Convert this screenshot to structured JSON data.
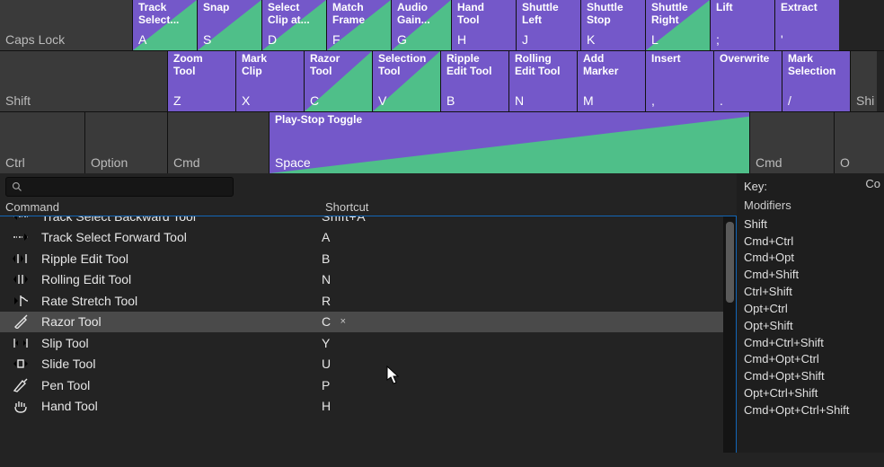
{
  "keyboard": {
    "row1_prefix": {
      "caps": "Caps Lock"
    },
    "row1": [
      {
        "top": "Track\nSelect...",
        "bot": "A",
        "intr": true,
        "triangle": true
      },
      {
        "top": "Snap",
        "bot": "S",
        "intr": true,
        "triangle": true
      },
      {
        "top": "Select\nClip at...",
        "bot": "D",
        "intr": true,
        "triangle": true
      },
      {
        "top": "Match\nFrame",
        "bot": "F",
        "intr": true,
        "triangle": true
      },
      {
        "top": "Audio\nGain...",
        "bot": "G",
        "intr": true,
        "triangle": true
      },
      {
        "top": "Hand\nTool",
        "bot": "H",
        "intr": true,
        "triangle": false
      },
      {
        "top": "Shuttle\nLeft",
        "bot": "J",
        "intr": true,
        "triangle": false
      },
      {
        "top": "Shuttle\nStop",
        "bot": "K",
        "intr": true,
        "triangle": false
      },
      {
        "top": "Shuttle\nRight",
        "bot": "L",
        "intr": true,
        "triangle": true
      },
      {
        "top": "Lift",
        "bot": ";",
        "intr": true,
        "triangle": false
      },
      {
        "top": "Extract",
        "bot": "'",
        "intr": true,
        "triangle": false
      }
    ],
    "row2_prefix": {
      "shift": "Shift"
    },
    "row2": [
      {
        "top": "Zoom\nTool",
        "bot": "Z",
        "intr": true,
        "triangle": false
      },
      {
        "top": "Mark\nClip",
        "bot": "X",
        "intr": true,
        "triangle": false
      },
      {
        "top": "Razor\nTool",
        "bot": "C",
        "intr": true,
        "triangle": true
      },
      {
        "top": "Selection\nTool",
        "bot": "V",
        "intr": true,
        "triangle": true
      },
      {
        "top": "Ripple\nEdit Tool",
        "bot": "B",
        "intr": true,
        "triangle": false
      },
      {
        "top": "Rolling\nEdit Tool",
        "bot": "N",
        "intr": true,
        "triangle": false
      },
      {
        "top": "Add\nMarker",
        "bot": "M",
        "intr": true,
        "triangle": false
      },
      {
        "top": "Insert",
        "bot": ",",
        "intr": true,
        "triangle": false
      },
      {
        "top": "Overwrite",
        "bot": ".",
        "intr": true,
        "triangle": false
      },
      {
        "top": "Mark\nSelection",
        "bot": "/",
        "intr": true,
        "triangle": false
      }
    ],
    "row2_suffix": {
      "type": "dark",
      "bot": "Shi"
    },
    "row3": [
      "Ctrl",
      "Option",
      "Cmd"
    ],
    "space": {
      "top": "Play-Stop Toggle",
      "bot": "Space"
    },
    "row3_right": [
      "Cmd",
      "O"
    ]
  },
  "panel": {
    "search_placeholder": "",
    "cols": {
      "command": "Command",
      "shortcut": "Shortcut"
    },
    "commands": [
      {
        "icon": "track-back",
        "name": "Track Select Backward Tool",
        "shortcut": "Shift+A"
      },
      {
        "icon": "track-fwd",
        "name": "Track Select Forward Tool",
        "shortcut": "A"
      },
      {
        "icon": "ripple",
        "name": "Ripple Edit Tool",
        "shortcut": "B"
      },
      {
        "icon": "rolling",
        "name": "Rolling Edit Tool",
        "shortcut": "N"
      },
      {
        "icon": "rate",
        "name": "Rate Stretch Tool",
        "shortcut": "R"
      },
      {
        "icon": "razor",
        "name": "Razor Tool",
        "shortcut": "C",
        "selected": true
      },
      {
        "icon": "slip",
        "name": "Slip Tool",
        "shortcut": "Y"
      },
      {
        "icon": "slide",
        "name": "Slide Tool",
        "shortcut": "U"
      },
      {
        "icon": "pen",
        "name": "Pen Tool",
        "shortcut": "P"
      },
      {
        "icon": "hand",
        "name": "Hand Tool",
        "shortcut": "H"
      }
    ]
  },
  "sidebar": {
    "key_header": "Key:",
    "mod_header": "Modifiers",
    "cmds_header": "Co",
    "modifiers": [
      "Shift",
      "Cmd+Ctrl",
      "Cmd+Opt",
      "Cmd+Shift",
      "Ctrl+Shift",
      "Opt+Ctrl",
      "Opt+Shift",
      "Cmd+Ctrl+Shift",
      "Cmd+Opt+Ctrl",
      "Cmd+Opt+Shift",
      "Opt+Ctrl+Shift",
      "Cmd+Opt+Ctrl+Shift"
    ]
  }
}
